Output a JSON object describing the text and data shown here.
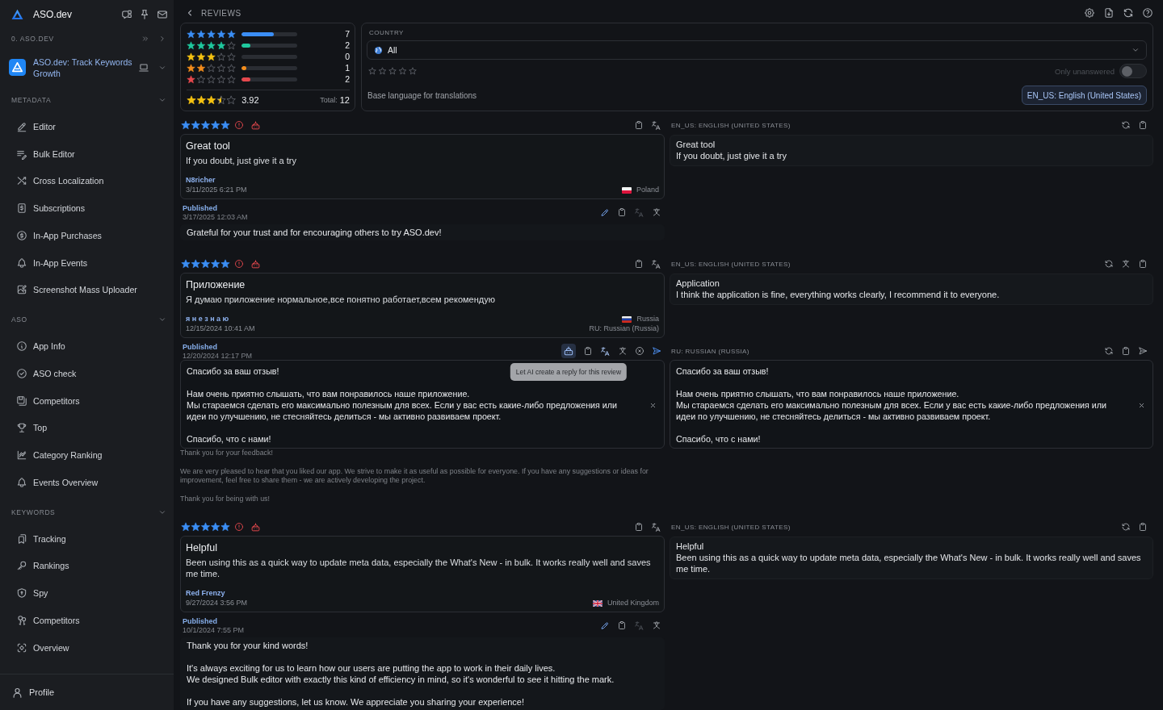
{
  "sidebar": {
    "brand": "ASO.dev",
    "workspace": "0. ASO.DEV",
    "app_name": "ASO.dev: Track Keywords Growth",
    "sections": [
      {
        "title": "METADATA",
        "expanded": true,
        "items": [
          "Editor",
          "Bulk Editor",
          "Cross Localization",
          "Subscriptions",
          "In-App Purchases",
          "In-App Events",
          "Screenshot Mass Uploader"
        ]
      },
      {
        "title": "ASO",
        "expanded": true,
        "items": [
          "App Info",
          "ASO check",
          "Competitors",
          "Top",
          "Category Ranking",
          "Events Overview"
        ]
      },
      {
        "title": "KEYWORDS",
        "expanded": true,
        "items": [
          "Tracking",
          "Rankings",
          "Spy",
          "Competitors",
          "Overview"
        ]
      }
    ],
    "profile": "Profile"
  },
  "page_title": "REVIEWS",
  "summary": {
    "rows": [
      {
        "stars": 5,
        "level": 0.58,
        "count": "7",
        "color": "#3b8ef5"
      },
      {
        "stars": 4,
        "level": 0.16,
        "count": "2",
        "color": "#1fc79d"
      },
      {
        "stars": 3,
        "count": "0",
        "color": "#f5c211"
      },
      {
        "stars": 2,
        "level": 0.08,
        "count": "1",
        "color": "#f28c1c"
      },
      {
        "stars": 1,
        "level": 0.16,
        "count": "2",
        "color": "#e5484d"
      }
    ],
    "average": {
      "stars": 3.5,
      "value": "3.92"
    },
    "total_label": "Total:",
    "total": "12"
  },
  "filters": {
    "country_label": "COUNTRY",
    "country": "All",
    "rating": {
      "stars": 0
    },
    "only_unanswered": {
      "label": "Only unanswered",
      "on": false,
      "disabled": true
    },
    "base_language_label": "Base language for translations",
    "base_language": "EN_US: English (United States)"
  },
  "reviews": [
    {
      "stars": 5,
      "title": "Great tool",
      "body": "If you doubt, just give it a try",
      "author": "N8richer",
      "date": "3/11/2025 6:21 PM",
      "country": "Poland",
      "translation": {
        "language": "EN_US: ENGLISH (UNITED STATES)",
        "title": "Great tool",
        "body": "If you doubt, just give it a try"
      },
      "reply": {
        "kind": "published",
        "status": "Published",
        "date": "3/17/2025 12:03 AM",
        "text": "Grateful for your trust and for encouraging others to try ASO.dev!"
      }
    },
    {
      "stars": 5,
      "title": "Приложение",
      "body": "Я думаю приложение нормальное,все понятно работает,всем рекомендую",
      "author": "я н е з н а ю",
      "date": "12/15/2024 10:41 AM",
      "country": "Russia",
      "language": "RU: Russian (Russia)",
      "translation": {
        "language": "EN_US: ENGLISH (UNITED STATES)",
        "title": "Application",
        "body": "I think the application is fine, everything works clearly, I recommend it to everyone."
      },
      "reply": {
        "kind": "draft",
        "status": "Published",
        "date": "12/20/2024 12:17 PM",
        "text": "Спасибо за ваш отзыв!\n\nНам очень приятно слышать, что вам понравилось наше приложение.\nМы стараемся сделать его максимально полезным для всех. Если у вас есть какие-либо предложения или идеи по улучшению, не стесняйтесь делиться - мы активно развиваем проект.\n\nСпасибо, что с нами!",
        "tooltip": "Let AI create a reply for this review",
        "translation": "Thank you for your feedback!\n\nWe are very pleased to hear that you liked our app. We strive to make it as useful as possible for everyone. If you have any suggestions or ideas for improvement, feel free to share them - we are actively developing the project.\n\nThank you for being with us!"
      },
      "reply_translation": {
        "language": "RU: RUSSIAN (RUSSIA)",
        "text": "Спасибо за ваш отзыв!\n\nНам очень приятно слышать, что вам понравилось наше приложение.\nМы стараемся сделать его максимально полезным для всех. Если у вас есть какие-либо предложения или идеи по улучшению, не стесняйтесь делиться - мы активно развиваем проект.\n\nСпасибо, что с нами!"
      }
    },
    {
      "stars": 5,
      "title": "Helpful",
      "body": "Been using this as a quick way to update meta data, especially the What's New - in bulk. It works really well and saves me time.",
      "author": "Red Frenzy",
      "date": "9/27/2024 3:56 PM",
      "country": "United Kingdom",
      "translation": {
        "language": "EN_US: ENGLISH (UNITED STATES)",
        "title": "Helpful",
        "body": "Been using this as a quick way to update meta data, especially the What's New - in bulk. It works really well and saves me time."
      },
      "reply": {
        "kind": "published",
        "status": "Published",
        "date": "10/1/2024 7:55 PM",
        "text": "Thank you for your kind words!\n\nIt's always exciting for us to learn how our users are putting the app to work in their daily lives.\nWe designed Bulk editor with exactly this kind of efficiency in mind, so it's wonderful to see it hitting the mark.\n\nIf you have any suggestions, let us know. We appreciate you sharing your experience!"
      }
    }
  ]
}
